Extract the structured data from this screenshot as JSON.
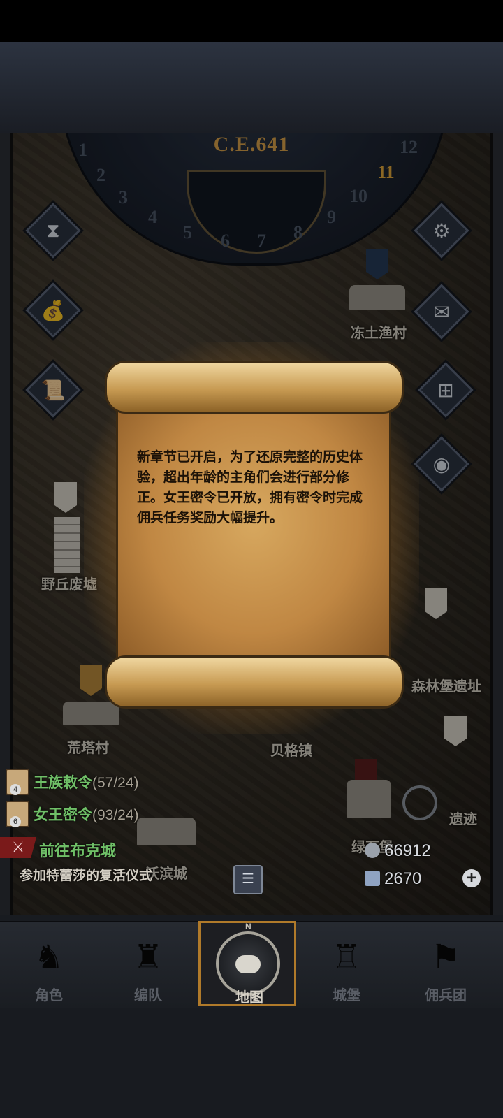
{
  "header": {
    "year": "C.E.641"
  },
  "calendar": {
    "months": [
      "1",
      "2",
      "3",
      "4",
      "5",
      "6",
      "7",
      "8",
      "9",
      "10",
      "11",
      "12"
    ],
    "current_month": "11"
  },
  "side_menu": {
    "left_icons": [
      "hourglass-icon",
      "money-bag-icon",
      "scroll-icon"
    ],
    "right_icons": [
      "gear-icon",
      "mail-icon",
      "grid-icon",
      "coin-icon"
    ]
  },
  "map": {
    "places": {
      "dongtu": "冻土渔村",
      "yeqiu": "野丘废墟",
      "huangta": "荒塔村",
      "beige": "贝格镇",
      "lvshi": "绿石堡",
      "wobin": "沃滨城",
      "senlin": "森林堡遗址",
      "yiji": "遗迹"
    }
  },
  "popup": {
    "message": "新章节已开启，为了还原完整的历史体验，超出年龄的主角们会进行部分修正。女王密令已开放，拥有密令时完成佣兵任务奖励大幅提升。"
  },
  "quests": {
    "royal": {
      "name": "王族敕令",
      "count": "(57/24)",
      "badge": "4"
    },
    "queen": {
      "name": "女王密令",
      "count": "(93/24)",
      "badge": "6"
    },
    "travel": "前往布克城",
    "task": "参加特蕾莎的复活仪式"
  },
  "resources": {
    "silver": "66912",
    "crystal": "2670"
  },
  "nav": {
    "tabs": [
      {
        "label": "角色"
      },
      {
        "label": "编队"
      },
      {
        "label": "地图"
      },
      {
        "label": "城堡"
      },
      {
        "label": "佣兵团"
      }
    ],
    "active": "地图",
    "compass_letter": "N"
  }
}
